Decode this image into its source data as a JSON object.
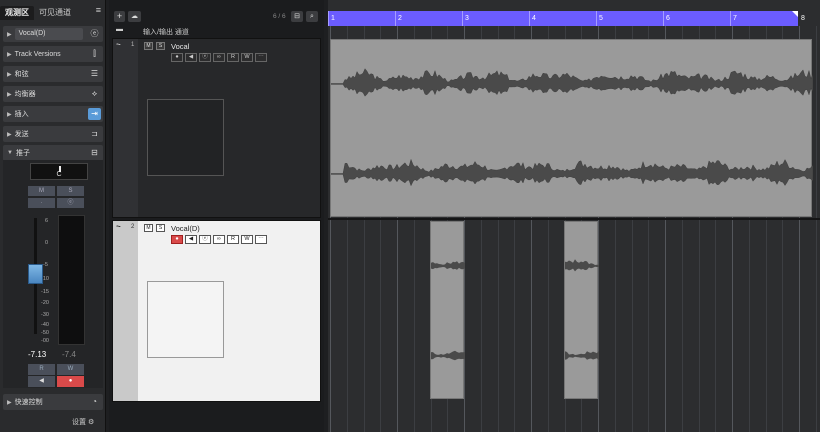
{
  "inspector": {
    "tabs": [
      "观测区",
      "可见通道"
    ],
    "menu_icon": "menu-icon",
    "track_name": "Vocal(D)",
    "sections": [
      {
        "label": "Track Versions",
        "icon": "versions-icon"
      },
      {
        "label": "和弦",
        "icon": "chord-icon"
      },
      {
        "label": "均衡器",
        "icon": "eq-icon"
      },
      {
        "label": "插入",
        "icon": "insert-icon"
      },
      {
        "label": "发送",
        "icon": "send-icon"
      },
      {
        "label": "推子",
        "icon": "fader-icon"
      }
    ],
    "pan_value": "C",
    "mute_label": "M",
    "solo_label": "S",
    "fader_scale": [
      "6",
      "0",
      "-5",
      "-10",
      "-15",
      "-20",
      "-30",
      "-40",
      "-50",
      "-00"
    ],
    "volume": "-7.13",
    "peak": "-7.4",
    "read_label": "R",
    "write_label": "W",
    "quick_controls": "快速控制",
    "settings": "设置"
  },
  "tracklist": {
    "count": "6 / 6",
    "folder_label": "输入/输出 通道",
    "tracks": [
      {
        "number": "1",
        "name": "Vocal"
      },
      {
        "number": "2",
        "name": "Vocal(D)"
      }
    ],
    "mute_label": "M",
    "solo_label": "S",
    "read_label": "R",
    "write_label": "W"
  },
  "ruler": {
    "bars": [
      "1",
      "2",
      "3",
      "4",
      "5",
      "6",
      "7",
      "8"
    ]
  },
  "colors": {
    "ruler": "#6b5cff",
    "record": "#d94a4a",
    "clip": "#9a9a9a",
    "inspector_blue": "#5a9bd8"
  }
}
